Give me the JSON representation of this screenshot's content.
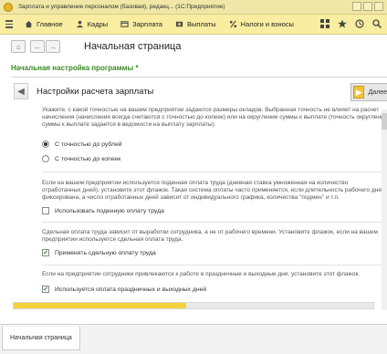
{
  "window": {
    "title": "Зарплата и управление персоналом (базовая), редакц... (1С:Предприятие)"
  },
  "sections": [
    {
      "label": "Главное",
      "icon": "home-icon"
    },
    {
      "label": "Кадры",
      "icon": "people-icon"
    },
    {
      "label": "Зарплата",
      "icon": "salary-icon"
    },
    {
      "label": "Выплаты",
      "icon": "payments-icon"
    },
    {
      "label": "Налоги и взносы",
      "icon": "percent-icon"
    }
  ],
  "nav": {
    "page_title": "Начальная страница"
  },
  "setup_title": "Начальная настройка программы *",
  "wizard": {
    "title": "Настройки расчета зарплаты",
    "next_label": "Далее",
    "precision_text": [
      "Укажите, с какой точностью на вашем предприятии задаются размеры окладов. Выбранная точность не влияет на расчет",
      "начисления (начисления всегда считаются с точностью до копеек) или на округление суммы к выплате (точность округления",
      "суммы к выплате задается в ведомости на выплату зарплаты)."
    ],
    "radio_rubles": "С точностью до рублей",
    "radio_kopecks": "С точностью до копеек",
    "hourly_text": [
      "Если на вашем предприятии используется поденная оплата труда (дневная ставка умноженная на количество",
      "отработанных дней), установите этот флажок. Такая система оплаты часто применяется, если длительность рабочего дня не",
      "фиксирована, а число отработанных дней зависит от индивидуального графика, количества \"подмен\" и т.п."
    ],
    "chk_daily": "Использовать поденную оплату труда",
    "piece_text": [
      "Сдельная оплата труда зависит от выработки сотрудника, а не от рабочего времени. Установите флажок, если на вашем",
      "предприятии используется сдельная оплата труда."
    ],
    "chk_piece": "Применять сдельную оплату труда",
    "holiday_text": [
      "Если на предприятии сотрудники привлекаются к работе в праздничные и выходные дни, установите этот флажок."
    ],
    "chk_holiday": "Используется оплата праздничных и выходных дней",
    "progress": 0.48
  },
  "bottom_tab": "Начальная страница",
  "colors": {
    "accent": "#3a8a23",
    "section_bar": "#f8eda0",
    "progress": "#f3d23d"
  }
}
